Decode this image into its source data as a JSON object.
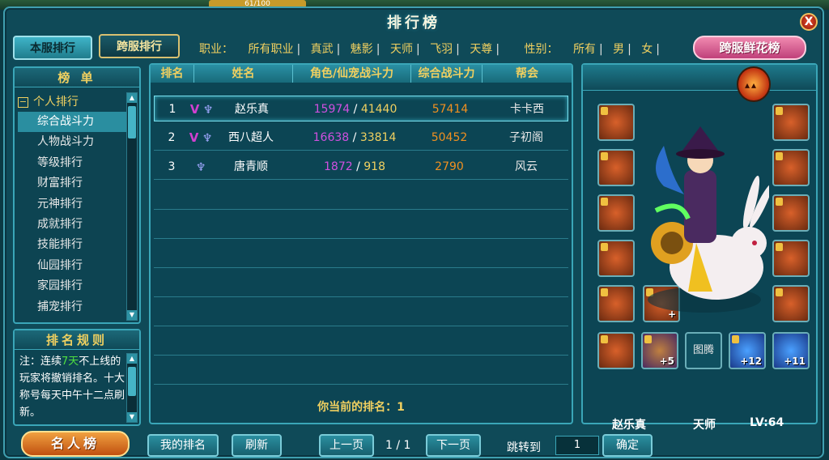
{
  "hud": {
    "xp_text": "61/100"
  },
  "window": {
    "title": "排行榜",
    "close_label": "X"
  },
  "tabs": {
    "local": "本服排行",
    "cross": "跨服排行"
  },
  "filters": {
    "job_label": "职业：",
    "job_options": [
      "所有职业",
      "真武",
      "魅影",
      "天师",
      "飞羽",
      "天尊"
    ],
    "gender_label": "性别：",
    "gender_options": [
      "所有",
      "男",
      "女"
    ]
  },
  "flower_button": "跨服鲜花榜",
  "sidebar": {
    "header": "榜  单",
    "root": "个人排行",
    "items": [
      "综合战斗力",
      "人物战斗力",
      "等级排行",
      "财富排行",
      "元神排行",
      "成就排行",
      "技能排行",
      "仙园排行",
      "家园排行",
      "捕宠排行"
    ],
    "active_index": 0
  },
  "rules": {
    "header": "排名规则",
    "line1_pre": "注：连续",
    "line1_days": "7天",
    "line1_post": "不上线的玩家将撤销排名。",
    "line2": "十大称号每天中午十二点刷新。"
  },
  "famous_button": "名人榜",
  "table": {
    "headers": [
      "排名",
      "姓名",
      "角色/仙宠战斗力",
      "综合战斗力",
      "帮会"
    ],
    "rows": [
      {
        "rank": "1",
        "vip": "V",
        "name": "赵乐真",
        "role_power": "15974",
        "pet_power": "41440",
        "total": "57414",
        "guild": "卡卡西"
      },
      {
        "rank": "2",
        "vip": "V",
        "name": "西八超人",
        "role_power": "16638",
        "pet_power": "33814",
        "total": "50452",
        "guild": "子初阁"
      },
      {
        "rank": "3",
        "vip": "",
        "name": "唐青顺",
        "role_power": "1872",
        "pet_power": "918",
        "total": "2790",
        "guild": "风云"
      }
    ],
    "my_rank_label": "你当前的排名：1"
  },
  "equipment": {
    "slots_left": [
      "armor",
      "wings",
      "ring",
      "talisman",
      "armor-2",
      "talisman-2"
    ],
    "slots_right": [
      "armor-3",
      "boots",
      "ring-2",
      "belt",
      "armor-4",
      "wing-badge"
    ],
    "bottom_slots": [
      {
        "label": "",
        "plus": ""
      },
      {
        "label": "",
        "plus": "+5"
      },
      {
        "label": "图腾",
        "plus": ""
      },
      {
        "label": "",
        "plus": "+12"
      },
      {
        "label": "",
        "plus": "+11"
      }
    ],
    "mid_slot_plus": "+"
  },
  "character": {
    "name": "赵乐真",
    "job": "天师",
    "level": "LV:64"
  },
  "footer": {
    "my_rank_button": "我的排名",
    "refresh_button": "刷新",
    "prev_button": "上一页",
    "page_indicator": "1 / 1",
    "next_button": "下一页",
    "jump_label": "跳转到",
    "jump_value": "1",
    "confirm_button": "确定"
  },
  "colors": {
    "panel_border": "#3aa6b8",
    "gold_text": "#f0d060",
    "power_purple": "#d050e0",
    "total_orange": "#f09020"
  }
}
